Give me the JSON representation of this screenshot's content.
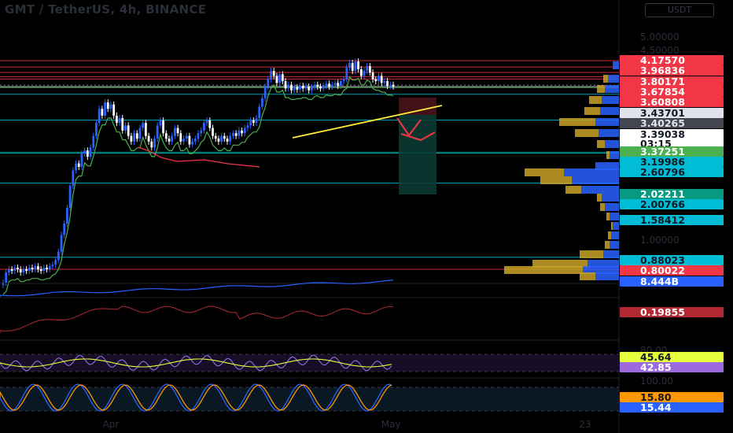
{
  "header": {
    "title": "GMT / TetherUS, 4h, BINANCE",
    "currency": "USDT"
  },
  "price_scale": {
    "ticks": [
      {
        "label": "5.00000",
        "value": 5.0
      },
      {
        "label": "4.50000",
        "value": 4.5
      },
      {
        "label": "1.00000",
        "value": 1.0
      }
    ]
  },
  "time_axis": {
    "ticks": [
      {
        "label": "Apr",
        "x": 0.14
      },
      {
        "label": "May",
        "x": 0.52
      },
      {
        "label": "23",
        "x": 0.79
      }
    ]
  },
  "price_tags": [
    {
      "label": "4.17570",
      "value": 4.1757,
      "bg": "#f23645",
      "fg": "#ffffff"
    },
    {
      "label": "3.96836",
      "value": 3.96836,
      "bg": "#f23645",
      "fg": "#ffffff"
    },
    {
      "label": "3.80171",
      "value": 3.80171,
      "bg": "#f23645",
      "fg": "#ffffff"
    },
    {
      "label": "3.67854",
      "value": 3.67854,
      "bg": "#f23645",
      "fg": "#ffffff"
    },
    {
      "label": "3.60808",
      "value": 3.60808,
      "bg": "#f23645",
      "fg": "#ffffff"
    },
    {
      "label": "3.43701",
      "value": 3.43701,
      "bg": "#e0e3eb",
      "fg": "#131722"
    },
    {
      "label": "3.40265",
      "value": 3.40265,
      "bg": "#434651",
      "fg": "#e0e3eb"
    },
    {
      "label": "3.39038",
      "value": 3.39038,
      "bg": "#ffffff",
      "fg": "#131722"
    },
    {
      "label": "03:15",
      "value": 3.33,
      "bg": "#ffffff",
      "fg": "#131722"
    },
    {
      "label": "3.37251",
      "value": 3.37251,
      "bg": "#4caf50",
      "fg": "#ffffff"
    },
    {
      "label": "3.19986",
      "value": 3.19986,
      "bg": "#00bcd4",
      "fg": "#131722"
    },
    {
      "label": "2.60796",
      "value": 2.60796,
      "bg": "#00bcd4",
      "fg": "#131722"
    },
    {
      "label": "2.02211",
      "value": 2.02211,
      "bg": "#089981",
      "fg": "#ffffff"
    },
    {
      "label": "2.00766",
      "value": 2.00766,
      "bg": "#00bcd4",
      "fg": "#131722"
    },
    {
      "label": "1.58412",
      "value": 1.58412,
      "bg": "#00bcd4",
      "fg": "#131722"
    },
    {
      "label": "0.88023",
      "value": 0.88023,
      "bg": "#00bcd4",
      "fg": "#131722"
    },
    {
      "label": "0.80022",
      "value": 0.80022,
      "bg": "#f23645",
      "fg": "#ffffff"
    }
  ],
  "indicator_tags": [
    {
      "label": "8.444B",
      "panel": "volume",
      "bg": "#2962ff",
      "fg": "#ffffff"
    },
    {
      "label": "0.19855",
      "panel": "osc",
      "bg": "#b22833",
      "fg": "#ffffff"
    },
    {
      "label": "45.64",
      "panel": "rsi",
      "bg": "#e5ff3d",
      "fg": "#131722"
    },
    {
      "label": "42.85",
      "panel": "rsi",
      "bg": "#9c6ade",
      "fg": "#ffffff"
    },
    {
      "label": "15.80",
      "panel": "stoch",
      "bg": "#ff9800",
      "fg": "#131722"
    },
    {
      "label": "15.44",
      "panel": "stoch",
      "bg": "#2962ff",
      "fg": "#ffffff"
    }
  ],
  "indicator_scale": {
    "rsi_top": "80.00",
    "stoch_top": "100.00"
  },
  "colors": {
    "up": "#2962ff",
    "down": "#ffffff",
    "support_line": "#00bcd4",
    "resistance_line": "#f23645",
    "trendline": "#ffeb3b",
    "trail_up": "#4caf50",
    "trail_down": "#f23645",
    "volume_profile_buy": "#2962ff",
    "volume_profile_sell": "#c9a227"
  },
  "chart_data": {
    "type": "candlestick",
    "title": "GMT / TetherUS, 4h, BINANCE",
    "ylim": [
      0.55,
      5.1
    ],
    "log_scale": true,
    "close_series": [
      0.72,
      0.78,
      0.8,
      0.79,
      0.81,
      0.8,
      0.78,
      0.8,
      0.79,
      0.81,
      0.8,
      0.82,
      0.8,
      0.79,
      0.81,
      0.8,
      0.82,
      0.83,
      0.86,
      0.92,
      1.05,
      1.15,
      1.3,
      1.55,
      1.75,
      1.85,
      1.8,
      2.0,
      2.05,
      1.95,
      2.1,
      2.3,
      2.55,
      2.85,
      2.7,
      3.0,
      2.85,
      2.95,
      2.7,
      2.55,
      2.65,
      2.4,
      2.5,
      2.3,
      2.2,
      2.35,
      2.25,
      2.45,
      2.55,
      2.3,
      2.2,
      2.1,
      2.25,
      2.5,
      2.6,
      2.35,
      2.25,
      2.2,
      2.3,
      2.45,
      2.35,
      2.2,
      2.25,
      2.3,
      2.15,
      2.2,
      2.25,
      2.35,
      2.4,
      2.55,
      2.6,
      2.45,
      2.3,
      2.25,
      2.2,
      2.3,
      2.25,
      2.2,
      2.3,
      2.35,
      2.3,
      2.4,
      2.35,
      2.45,
      2.5,
      2.6,
      2.55,
      2.65,
      2.9,
      3.1,
      3.4,
      3.6,
      3.85,
      3.7,
      3.5,
      3.75,
      3.55,
      3.35,
      3.45,
      3.3,
      3.38,
      3.32,
      3.42,
      3.35,
      3.4,
      3.3,
      3.38,
      3.45,
      3.4,
      3.35,
      3.42,
      3.48,
      3.4,
      3.45,
      3.5,
      3.42,
      3.55,
      3.6,
      3.95,
      4.1,
      3.85,
      4.15,
      3.9,
      3.7,
      3.85,
      4.0,
      3.8,
      3.6,
      3.55,
      3.7,
      3.5,
      3.55,
      3.42,
      3.45,
      3.4
    ]
  }
}
